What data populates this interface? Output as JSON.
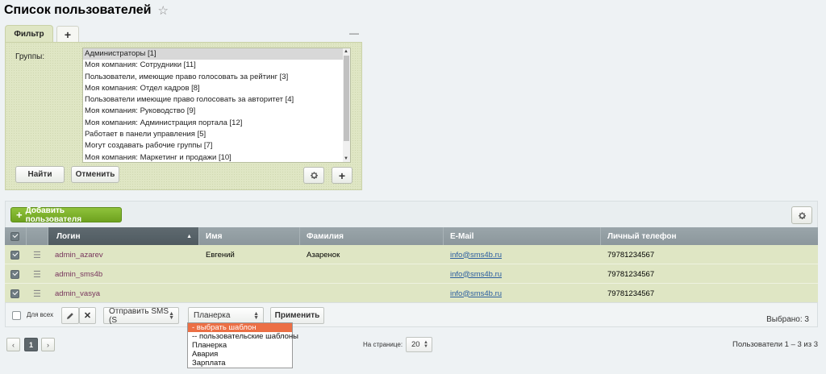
{
  "page": {
    "title": "Список пользователей",
    "favorite_icon": "star-icon"
  },
  "filter": {
    "tab_label": "Фильтр",
    "add_tab_icon": "plus-icon",
    "collapse_icon": "minus-icon",
    "groups_label": "Группы:",
    "groups": [
      "Администраторы [1]",
      "Моя компания: Сотрудники [11]",
      "Пользователи, имеющие право голосовать за рейтинг [3]",
      "Моя компания: Отдел кадров [8]",
      "Пользователи имеющие право голосовать за авторитет [4]",
      "Моя компания: Руководство [9]",
      "Моя компания: Администрация портала [12]",
      "Работает в панели управления [5]",
      "Могут создавать рабочие группы [7]",
      "Моя компания: Маркетинг и продажи [10]"
    ],
    "selected_group_index": 0,
    "find_label": "Найти",
    "cancel_label": "Отменить"
  },
  "toolbar": {
    "add_user_label": "Добавить пользователя",
    "settings_icon": "gear-icon"
  },
  "grid": {
    "columns": [
      "Логин",
      "Имя",
      "Фамилия",
      "E-Mail",
      "Личный телефон"
    ],
    "sorted_column": "Логин",
    "sort_direction": "asc",
    "rows": [
      {
        "login": "admin_azarev",
        "name": "Евгений",
        "surname": "Азаренок",
        "email": "info@sms4b.ru",
        "phone": "79781234567",
        "checked": true
      },
      {
        "login": "admin_sms4b",
        "name": "",
        "surname": "",
        "email": "info@sms4b.ru",
        "phone": "79781234567",
        "checked": true
      },
      {
        "login": "admin_vasya",
        "name": "",
        "surname": "",
        "email": "info@sms4b.ru",
        "phone": "79781234567",
        "checked": true
      }
    ]
  },
  "footer": {
    "for_all_label": "Для всех",
    "send_sms_label": "Отправить SMS (S",
    "template_select_value": "Планерка",
    "apply_label": "Применить",
    "selected_label": "Выбрано: 3"
  },
  "template_dropdown": {
    "options": [
      "- выбрать шаблон",
      "-- пользовательские шаблоны",
      "Планерка",
      "Авария",
      "Зарплата"
    ],
    "highlighted_index": 0
  },
  "pagination": {
    "current_page": "1",
    "per_page_label": "На странице:",
    "per_page_value": "20",
    "summary": "Пользователи 1 – 3 из 3"
  }
}
